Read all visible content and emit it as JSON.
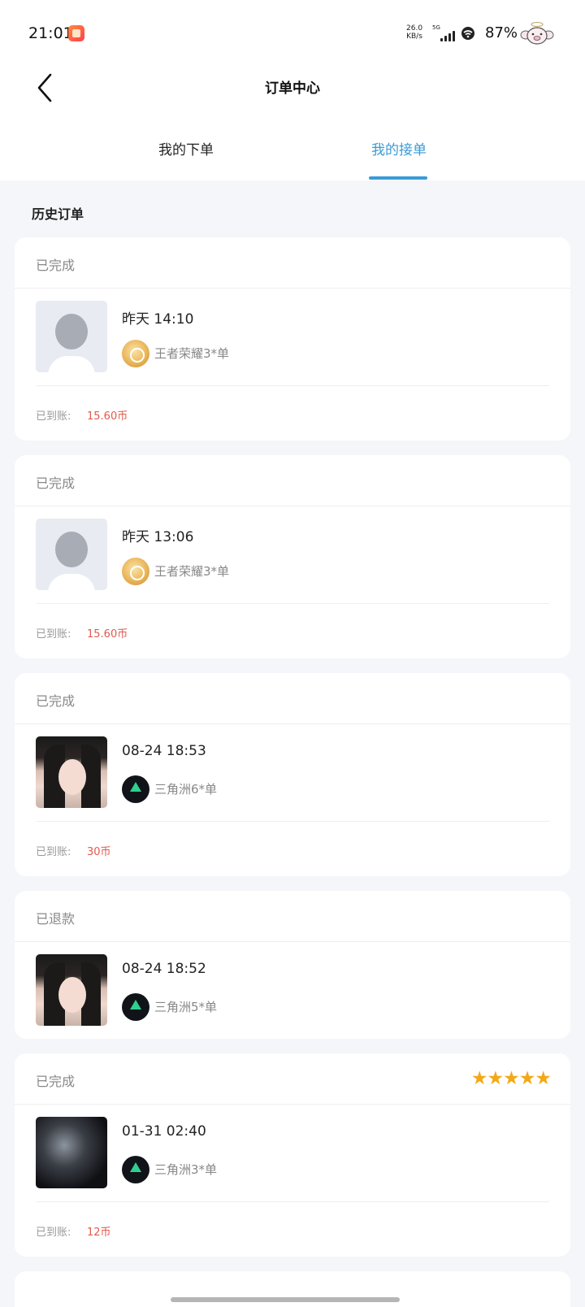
{
  "status_bar": {
    "time": "21:01",
    "net_speed_value": "26.0",
    "net_speed_unit": "KB/s",
    "network": "5G",
    "battery": "87%"
  },
  "nav": {
    "title": "订单中心"
  },
  "tabs": [
    {
      "label": "我的下单",
      "active": false
    },
    {
      "label": "我的接单",
      "active": true
    }
  ],
  "accent_color": "#3a9bd8",
  "price_color": "#e05a4e",
  "section_title": "历史订单",
  "arrived_label": "已到账:",
  "orders": [
    {
      "status": "已完成",
      "date": "昨天 14:10",
      "game": "王者荣耀3*单",
      "game_icon": "honor-of-kings-icon",
      "avatar": "default-avatar",
      "amount": "15.60币"
    },
    {
      "status": "已完成",
      "date": "昨天 13:06",
      "game": "王者荣耀3*单",
      "game_icon": "honor-of-kings-icon",
      "avatar": "default-avatar",
      "amount": "15.60币"
    },
    {
      "status": "已完成",
      "date": "08-24  18:53",
      "game": "三角洲6*单",
      "game_icon": "delta-force-icon",
      "avatar": "user-photo",
      "amount": "30币"
    },
    {
      "status": "已退款",
      "date": "08-24  18:52",
      "game": "三角洲5*单",
      "game_icon": "delta-force-icon",
      "avatar": "user-photo"
    },
    {
      "status": "已完成",
      "rating_stars": 5,
      "date": "01-31  02:40",
      "game": "三角洲3*单",
      "game_icon": "delta-force-icon",
      "avatar": "user-photo-dark",
      "amount": "12币"
    }
  ]
}
